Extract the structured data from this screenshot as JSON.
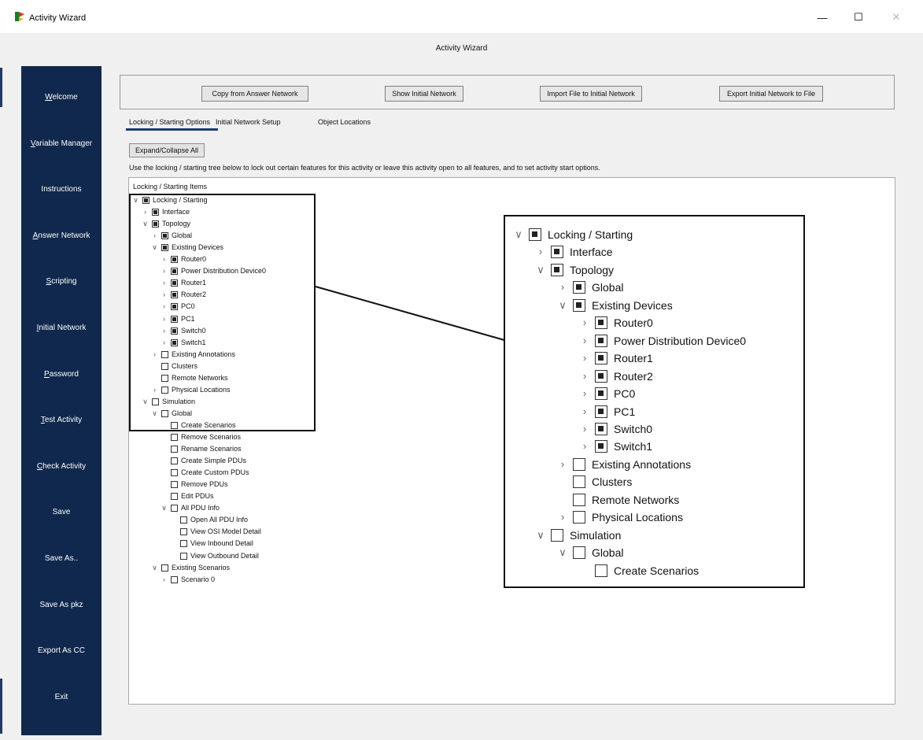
{
  "window": {
    "title": "Activity Wizard",
    "controls": {
      "minimize": "—",
      "maximize": "☐",
      "close": "✕"
    }
  },
  "header": {
    "title": "Activity Wizard"
  },
  "sidebar": {
    "items": [
      {
        "label": "Welcome",
        "accel": "W",
        "rest": "elcome"
      },
      {
        "label": "Variable Manager",
        "accel": "V",
        "rest": "ariable Manager"
      },
      {
        "label": "Instructions",
        "accel": "",
        "rest": "Instructions"
      },
      {
        "label": "Answer Network",
        "accel": "A",
        "rest": "nswer Network"
      },
      {
        "label": "Scripting",
        "accel": "S",
        "rest": "cripting"
      },
      {
        "label": "Initial Network",
        "accel": "I",
        "rest": "nitial Network"
      },
      {
        "label": "Password",
        "accel": "P",
        "rest": "assword"
      },
      {
        "label": "Test Activity",
        "accel": "T",
        "rest": "est Activity"
      },
      {
        "label": "Check Activity",
        "accel": "C",
        "rest": "heck Activity"
      },
      {
        "label": "Save",
        "accel": "",
        "rest": "Save"
      },
      {
        "label": "Save As..",
        "accel": "",
        "rest": "Save As.."
      },
      {
        "label": "Save As pkz",
        "accel": "",
        "rest": "Save As pkz"
      },
      {
        "label": "Export As CC",
        "accel": "",
        "rest": "Export As CC"
      },
      {
        "label": "Exit",
        "accel": "",
        "rest": "Exit"
      }
    ]
  },
  "actions": {
    "copy": "Copy from Answer Network",
    "show": "Show Initial Network",
    "import": "Import File to Initial Network",
    "export": "Export Initial Network to File"
  },
  "tabs": {
    "locking": "Locking / Starting Options",
    "initial": "Initial Network Setup",
    "objects": "Object Locations"
  },
  "expand_label": "Expand/Collapse All",
  "instructions_text": "Use the locking / starting tree below to lock out certain features for this activity or leave this activity open to all features, and to set activity start options.",
  "tree_caption": "Locking / Starting Items",
  "tree": [
    {
      "label": "Locking / Starting",
      "level": 0,
      "expander": "open",
      "state": "partial"
    },
    {
      "label": "Interface",
      "level": 1,
      "expander": "closed",
      "state": "partial"
    },
    {
      "label": "Topology",
      "level": 1,
      "expander": "open",
      "state": "partial"
    },
    {
      "label": "Global",
      "level": 2,
      "expander": "closed",
      "state": "partial"
    },
    {
      "label": "Existing Devices",
      "level": 2,
      "expander": "open",
      "state": "partial"
    },
    {
      "label": "Router0",
      "level": 3,
      "expander": "closed",
      "state": "partial"
    },
    {
      "label": "Power Distribution Device0",
      "level": 3,
      "expander": "closed",
      "state": "partial"
    },
    {
      "label": "Router1",
      "level": 3,
      "expander": "closed",
      "state": "partial"
    },
    {
      "label": "Router2",
      "level": 3,
      "expander": "closed",
      "state": "partial"
    },
    {
      "label": "PC0",
      "level": 3,
      "expander": "closed",
      "state": "partial"
    },
    {
      "label": "PC1",
      "level": 3,
      "expander": "closed",
      "state": "partial"
    },
    {
      "label": "Switch0",
      "level": 3,
      "expander": "closed",
      "state": "partial"
    },
    {
      "label": "Switch1",
      "level": 3,
      "expander": "closed",
      "state": "partial"
    },
    {
      "label": "Existing Annotations",
      "level": 2,
      "expander": "closed",
      "state": "unchecked"
    },
    {
      "label": "Clusters",
      "level": 2,
      "expander": "none",
      "state": "unchecked"
    },
    {
      "label": "Remote Networks",
      "level": 2,
      "expander": "none",
      "state": "unchecked"
    },
    {
      "label": "Physical Locations",
      "level": 2,
      "expander": "closed",
      "state": "unchecked"
    },
    {
      "label": "Simulation",
      "level": 1,
      "expander": "open",
      "state": "unchecked"
    },
    {
      "label": "Global",
      "level": 2,
      "expander": "open",
      "state": "unchecked"
    },
    {
      "label": "Create Scenarios",
      "level": 3,
      "expander": "none",
      "state": "unchecked"
    },
    {
      "label": "Remove Scenarios",
      "level": 3,
      "expander": "none",
      "state": "unchecked"
    },
    {
      "label": "Rename Scenarios",
      "level": 3,
      "expander": "none",
      "state": "unchecked"
    },
    {
      "label": "Create Simple PDUs",
      "level": 3,
      "expander": "none",
      "state": "unchecked"
    },
    {
      "label": "Create Custom PDUs",
      "level": 3,
      "expander": "none",
      "state": "unchecked"
    },
    {
      "label": "Remove PDUs",
      "level": 3,
      "expander": "none",
      "state": "unchecked"
    },
    {
      "label": "Edit PDUs",
      "level": 3,
      "expander": "none",
      "state": "unchecked"
    },
    {
      "label": "All PDU Info",
      "level": 3,
      "expander": "open",
      "state": "unchecked"
    },
    {
      "label": "Open All PDU Info",
      "level": 4,
      "expander": "none",
      "state": "unchecked"
    },
    {
      "label": "View OSI Model Detail",
      "level": 4,
      "expander": "none",
      "state": "unchecked"
    },
    {
      "label": "View Inbound Detail",
      "level": 4,
      "expander": "none",
      "state": "unchecked"
    },
    {
      "label": "View Outbound Detail",
      "level": 4,
      "expander": "none",
      "state": "unchecked"
    },
    {
      "label": "Existing Scenarios",
      "level": 2,
      "expander": "open",
      "state": "unchecked"
    },
    {
      "label": "Scenario 0",
      "level": 3,
      "expander": "closed",
      "state": "unchecked"
    }
  ],
  "zoom_rows": 20
}
